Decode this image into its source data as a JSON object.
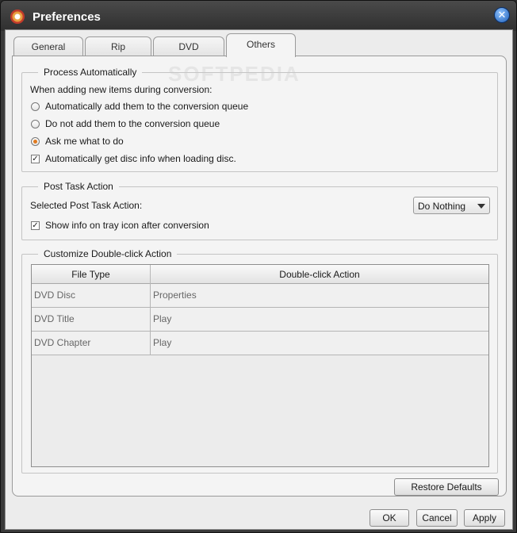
{
  "window": {
    "title": "Preferences",
    "close_glyph": "✕"
  },
  "watermark": "SOFTPEDIA",
  "tabs": [
    {
      "label": "General",
      "active": false
    },
    {
      "label": "Rip",
      "active": false
    },
    {
      "label": "DVD",
      "active": false
    },
    {
      "label": "Others",
      "active": true
    }
  ],
  "process": {
    "title": "Process Automatically",
    "intro": "When adding new items during conversion:",
    "options": [
      {
        "label": "Automatically add them to the conversion queue",
        "selected": false
      },
      {
        "label": "Do not add them to the conversion queue",
        "selected": false
      },
      {
        "label": "Ask me what to do",
        "selected": true
      }
    ],
    "disc_info": {
      "label": "Automatically get disc info when loading disc.",
      "checked": true
    }
  },
  "post_task": {
    "title": "Post Task Action",
    "label": "Selected Post Task Action:",
    "value": "Do Nothing",
    "tray_info": {
      "label": "Show info on tray icon after conversion",
      "checked": true
    }
  },
  "double_click": {
    "title": "Customize Double-click Action",
    "columns": [
      "File Type",
      "Double-click Action"
    ],
    "rows": [
      [
        "DVD Disc",
        "Properties"
      ],
      [
        "DVD Title",
        "Play"
      ],
      [
        "DVD Chapter",
        "Play"
      ]
    ]
  },
  "buttons": {
    "restore_defaults": "Restore Defaults",
    "ok": "OK",
    "cancel": "Cancel",
    "apply": "Apply"
  },
  "colors": {
    "accent": "#e07a1f",
    "title_bar": "#3a3a3a"
  }
}
